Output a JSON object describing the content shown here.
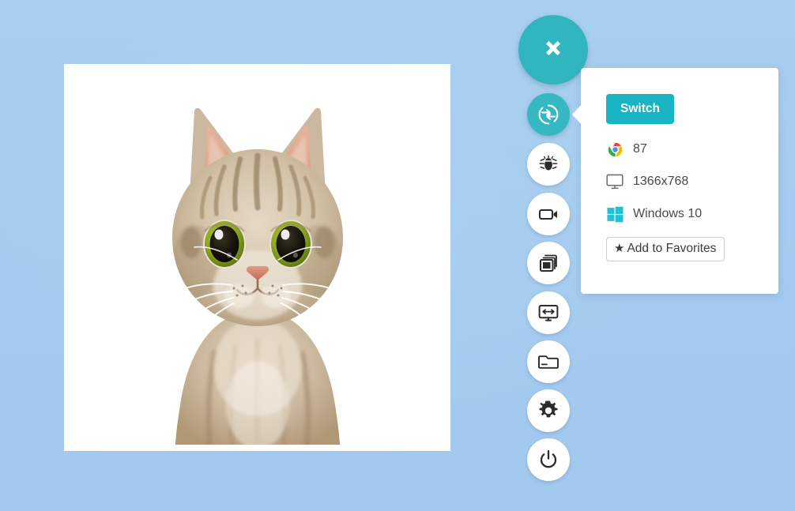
{
  "background": {
    "color_top": "#a8cef1",
    "color_bottom": "#a2c9ee"
  },
  "content": {
    "card_name": "screenshot-preview-card",
    "image_subject": "cat",
    "image_alt": "Tabby cat head on white background"
  },
  "sidebar": {
    "close": {
      "icon": "close-x-icon",
      "label": "Close"
    },
    "items": [
      {
        "icon": "switch-browser-icon",
        "label": "Switch Browser",
        "active": true
      },
      {
        "icon": "bug-icon",
        "label": "Report a Bug",
        "active": false
      },
      {
        "icon": "video-camera-icon",
        "label": "Record Video",
        "active": false
      },
      {
        "icon": "screenshot-icon",
        "label": "Screenshot",
        "active": false
      },
      {
        "icon": "responsive-monitor-icon",
        "label": "Responsive",
        "active": false
      },
      {
        "icon": "folder-icon",
        "label": "Files",
        "active": false
      },
      {
        "icon": "gear-icon",
        "label": "Settings",
        "active": false
      },
      {
        "icon": "power-icon",
        "label": "Stop Session",
        "active": false
      }
    ]
  },
  "popup": {
    "switch_label": "Switch",
    "switch_color": "#18b4c4",
    "rows": [
      {
        "icon": "chrome-icon",
        "text": "87"
      },
      {
        "icon": "monitor-icon",
        "text": "1366x768"
      },
      {
        "icon": "windows-icon",
        "text": "Windows 10"
      }
    ],
    "favorites_label": "Add to Favorites",
    "favorites_star": "★"
  }
}
